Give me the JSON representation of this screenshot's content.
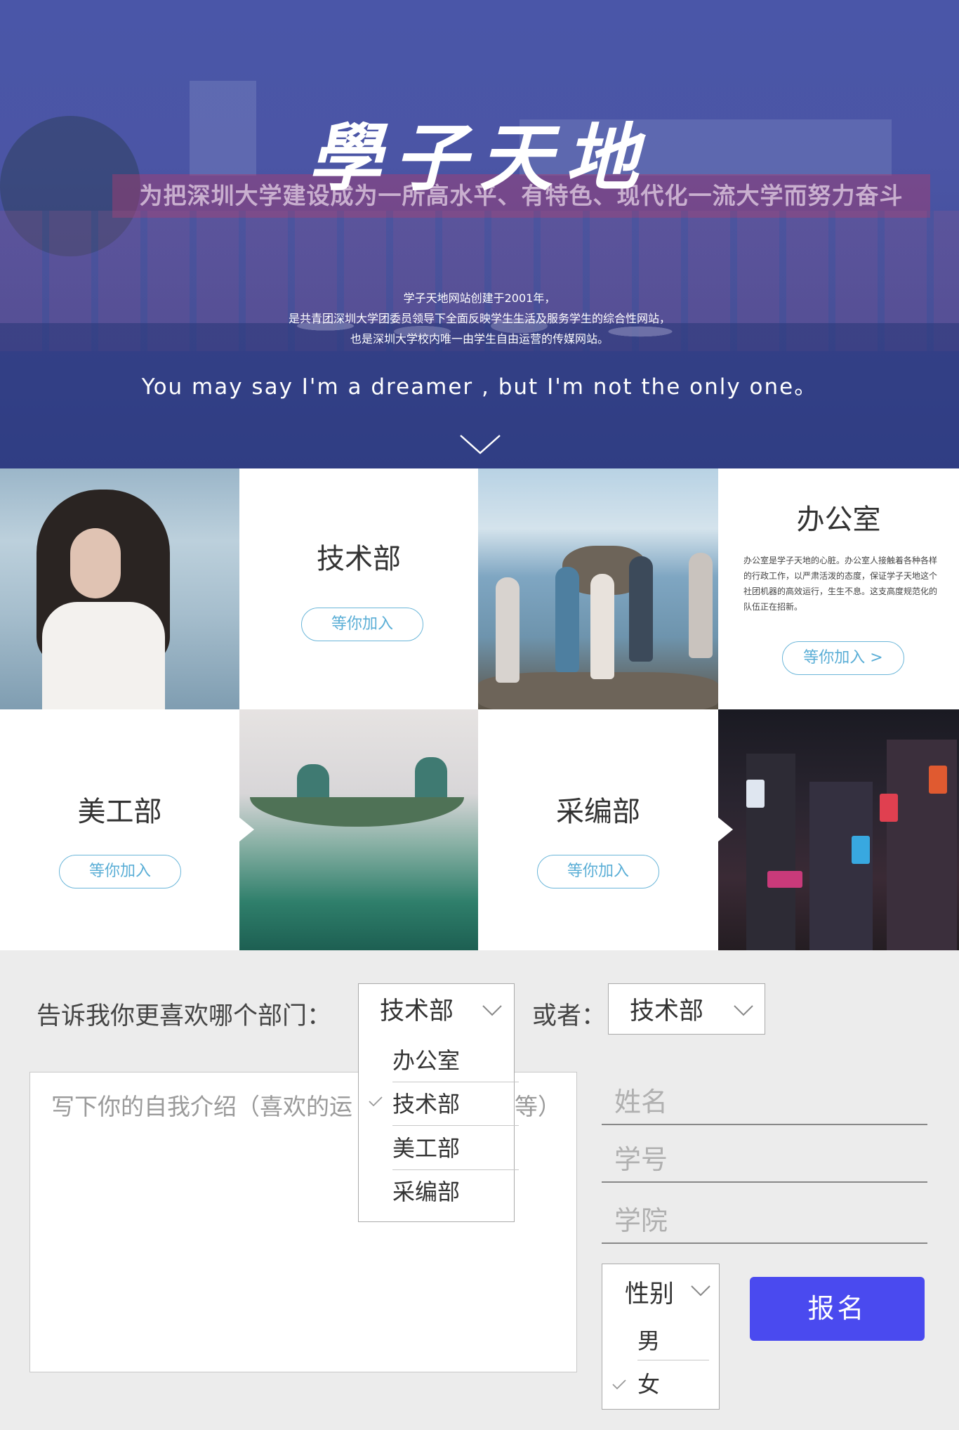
{
  "hero": {
    "title": "學子天地",
    "banner_text": "为把深圳大学建设成为一所高水平、有特色、现代化一流大学而努力奋斗",
    "description_lines": [
      "学子天地网站创建于2001年，",
      "是共青团深圳大学团委员领导下全面反映学生生活及服务学生的综合性网站，",
      "也是深圳大学校内唯一由学生自由运营的传媒网站。"
    ],
    "quote": "You may say I'm a dreamer , but I'm not the only one。",
    "scroll_icon": "chevron-down-icon"
  },
  "departments": {
    "tech": {
      "title": "技术部",
      "button": "等你加入"
    },
    "office": {
      "title": "办公室",
      "description": "办公室是学子天地的心脏。办公室人接触着各种各样的行政工作，以严肃活泼的态度，保证学子天地这个社团机器的高效运行，生生不息。这支高度规范化的队伍正在招新。",
      "button": "等你加入 >"
    },
    "art": {
      "title": "美工部",
      "button": "等你加入"
    },
    "editorial": {
      "title": "采编部",
      "button": "等你加入"
    }
  },
  "form": {
    "question_label": "告诉我你更喜欢哪个部门：",
    "or_label": "或者：",
    "primary_select": {
      "value": "技术部",
      "options": [
        "办公室",
        "技术部",
        "美工部",
        "采编部"
      ],
      "selected_index": 1
    },
    "secondary_select": {
      "value": "技术部"
    },
    "intro_placeholder": "写下你的自我介绍（喜欢的运",
    "intro_placeholder_tail": "等）",
    "name_placeholder": "姓名",
    "student_id_placeholder": "学号",
    "college_placeholder": "学院",
    "gender_select": {
      "label": "性别",
      "options": [
        "男",
        "女"
      ],
      "selected_index": 1
    },
    "submit_label": "报名"
  },
  "colors": {
    "hero_overlay": "#4a56a8",
    "accent_button": "#6bb6d9",
    "submit": "#4a4aef",
    "form_bg": "#ececec"
  }
}
